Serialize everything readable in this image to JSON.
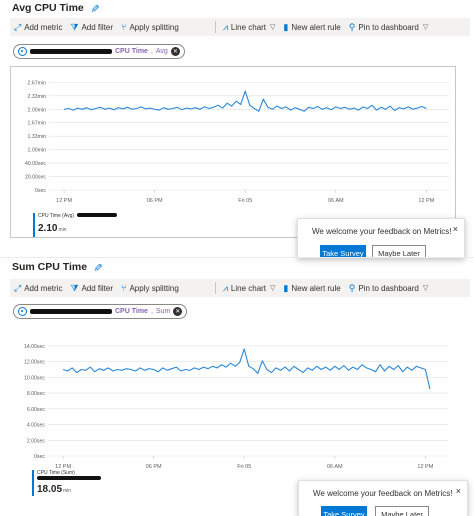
{
  "colors": {
    "accent": "#0078d4",
    "line": "#2b88d8",
    "metric_name": "#8764b8",
    "grid": "#e1dfdd"
  },
  "toolbar": {
    "add_metric": "Add metric",
    "add_filter": "Add filter",
    "apply_splitting": "Apply splitting",
    "line_chart": "Line chart",
    "new_alert_rule": "New alert rule",
    "pin_to_dashboard": "Pin to dashboard"
  },
  "panels": [
    {
      "title": "Avg CPU Time",
      "pill": {
        "metric": "CPU Time",
        "aggregation": "Avg"
      },
      "legend": {
        "name": "CPU Time (Avg)",
        "value": "2.10",
        "unit": "min"
      },
      "survey": {
        "text": "We welcome your feedback on Metrics!",
        "primary": "Take Survey",
        "secondary": "Maybe Later",
        "close": "×"
      }
    },
    {
      "title": "Sum CPU Time",
      "pill": {
        "metric": "CPU Time",
        "aggregation": "Sum"
      },
      "legend": {
        "name": "CPU Time (Sum)",
        "value": "18.05",
        "unit": "min"
      },
      "survey": {
        "text": "We welcome your feedback on Metrics!",
        "primary": "Take Survey",
        "secondary": "Maybe Later",
        "close": "×"
      }
    }
  ],
  "chart_data": [
    {
      "type": "line",
      "title": "Avg CPU Time",
      "y_tick_labels": [
        "2.67min",
        "2.33min",
        "2.00min",
        "1.67min",
        "1.33min",
        "1.00min",
        "40.00sec",
        "20.00sec",
        "0sec"
      ],
      "y_ticks_minutes": [
        2.6667,
        2.3333,
        2.0,
        1.6667,
        1.3333,
        1.0,
        0.6667,
        0.3333,
        0
      ],
      "ylim_minutes": [
        0,
        2.8
      ],
      "x_tick_labels": [
        "12 PM",
        "06 PM",
        "Fri 05",
        "06 AM",
        "12 PM"
      ],
      "x_tick_hours": [
        0,
        6,
        12,
        18,
        24
      ],
      "xlim_hours": [
        -1,
        25.5
      ],
      "grid": true,
      "series": [
        {
          "name": "CPU Time (Avg)",
          "x_hours": [
            0,
            0.3,
            0.6,
            0.9,
            1.2,
            1.5,
            1.8,
            2.1,
            2.4,
            2.7,
            3,
            3.3,
            3.6,
            3.9,
            4.2,
            4.5,
            4.8,
            5.1,
            5.4,
            5.7,
            6,
            6.3,
            6.6,
            6.9,
            7.2,
            7.5,
            7.8,
            8.1,
            8.4,
            8.7,
            9,
            9.3,
            9.6,
            9.9,
            10.2,
            10.5,
            10.8,
            11.1,
            11.4,
            11.7,
            12,
            12.3,
            12.6,
            12.9,
            13.2,
            13.5,
            13.8,
            14.1,
            14.4,
            14.7,
            15,
            15.3,
            15.6,
            15.9,
            16.2,
            16.5,
            16.8,
            17.1,
            17.4,
            17.7,
            18,
            18.3,
            18.6,
            18.9,
            19.2,
            19.5,
            19.8,
            20.1,
            20.4,
            20.7,
            21,
            21.3,
            21.6,
            21.9,
            22.2,
            22.5,
            22.8,
            23.1,
            23.4,
            23.7,
            24
          ],
          "values": [
            2.0,
            2.02,
            1.98,
            2.03,
            2.0,
            2.04,
            1.99,
            2.02,
            2.05,
            2.0,
            2.03,
            1.99,
            2.04,
            2.01,
            2.05,
            2.0,
            2.02,
            2.06,
            2.01,
            2.03,
            2.0,
            1.98,
            2.04,
            2.0,
            2.02,
            2.05,
            1.99,
            2.03,
            2.01,
            2.04,
            2.0,
            2.06,
            2.02,
            2.05,
            2.1,
            2.03,
            2.15,
            2.08,
            2.2,
            2.12,
            2.45,
            2.1,
            2.02,
            1.95,
            2.25,
            2.05,
            2.0,
            2.08,
            2.02,
            2.06,
            1.98,
            2.04,
            2.0,
            1.95,
            2.05,
            2.02,
            2.07,
            2.0,
            2.04,
            1.99,
            2.06,
            2.02,
            2.05,
            2.0,
            2.03,
            1.98,
            2.06,
            2.02,
            2.1,
            1.98,
            2.05,
            2.0,
            2.08,
            1.97,
            2.04,
            2.01,
            2.06,
            2.0,
            2.03,
            2.07,
            2.02
          ]
        }
      ]
    },
    {
      "type": "line",
      "title": "Sum CPU Time",
      "y_tick_labels": [
        "14.00sec",
        "12.00sec",
        "10.00sec",
        "8.00sec",
        "6.00sec",
        "4.00sec",
        "2.00sec",
        "0sec"
      ],
      "y_ticks_seconds": [
        14,
        12,
        10,
        8,
        6,
        4,
        2,
        0
      ],
      "ylim_seconds": [
        0,
        15
      ],
      "x_tick_labels": [
        "12 PM",
        "06 PM",
        "Fri 05",
        "06 AM",
        "12 PM"
      ],
      "x_tick_hours": [
        0,
        6,
        12,
        18,
        24
      ],
      "xlim_hours": [
        -1,
        25.5
      ],
      "grid": true,
      "series": [
        {
          "name": "CPU Time (Sum)",
          "x_hours": [
            0,
            0.3,
            0.6,
            0.9,
            1.2,
            1.5,
            1.8,
            2.1,
            2.4,
            2.7,
            3,
            3.3,
            3.6,
            3.9,
            4.2,
            4.5,
            4.8,
            5.1,
            5.4,
            5.7,
            6,
            6.3,
            6.6,
            6.9,
            7.2,
            7.5,
            7.8,
            8.1,
            8.4,
            8.7,
            9,
            9.3,
            9.6,
            9.9,
            10.2,
            10.5,
            10.8,
            11.1,
            11.4,
            11.7,
            12,
            12.3,
            12.6,
            12.9,
            13.2,
            13.5,
            13.8,
            14.1,
            14.4,
            14.7,
            15,
            15.3,
            15.6,
            15.9,
            16.2,
            16.5,
            16.8,
            17.1,
            17.4,
            17.7,
            18,
            18.3,
            18.6,
            18.9,
            19.2,
            19.5,
            19.8,
            20.1,
            20.4,
            20.7,
            21,
            21.3,
            21.6,
            21.9,
            22.2,
            22.5,
            22.8,
            23.1,
            23.4,
            23.7,
            24,
            24.3
          ],
          "values": [
            11.0,
            10.8,
            11.2,
            10.6,
            11.0,
            10.9,
            11.3,
            10.7,
            11.1,
            10.9,
            11.2,
            10.8,
            11.0,
            10.9,
            11.1,
            11.0,
            10.8,
            11.2,
            10.9,
            11.1,
            11.0,
            10.7,
            11.2,
            10.9,
            11.1,
            11.3,
            10.8,
            11.0,
            10.9,
            11.2,
            11.0,
            11.3,
            11.1,
            11.4,
            11.2,
            11.6,
            11.3,
            11.8,
            11.4,
            11.9,
            13.6,
            11.4,
            11.1,
            10.5,
            12.1,
            11.0,
            10.6,
            11.2,
            10.9,
            11.3,
            10.8,
            11.4,
            11.0,
            10.6,
            11.2,
            10.9,
            11.4,
            11.0,
            11.3,
            10.9,
            11.4,
            11.0,
            11.5,
            10.9,
            11.3,
            11.0,
            11.6,
            11.2,
            11.0,
            10.7,
            11.6,
            10.8,
            11.4,
            11.0,
            11.5,
            10.7,
            11.3,
            10.9,
            11.4,
            11.2,
            11.0,
            8.5
          ]
        }
      ]
    }
  ]
}
